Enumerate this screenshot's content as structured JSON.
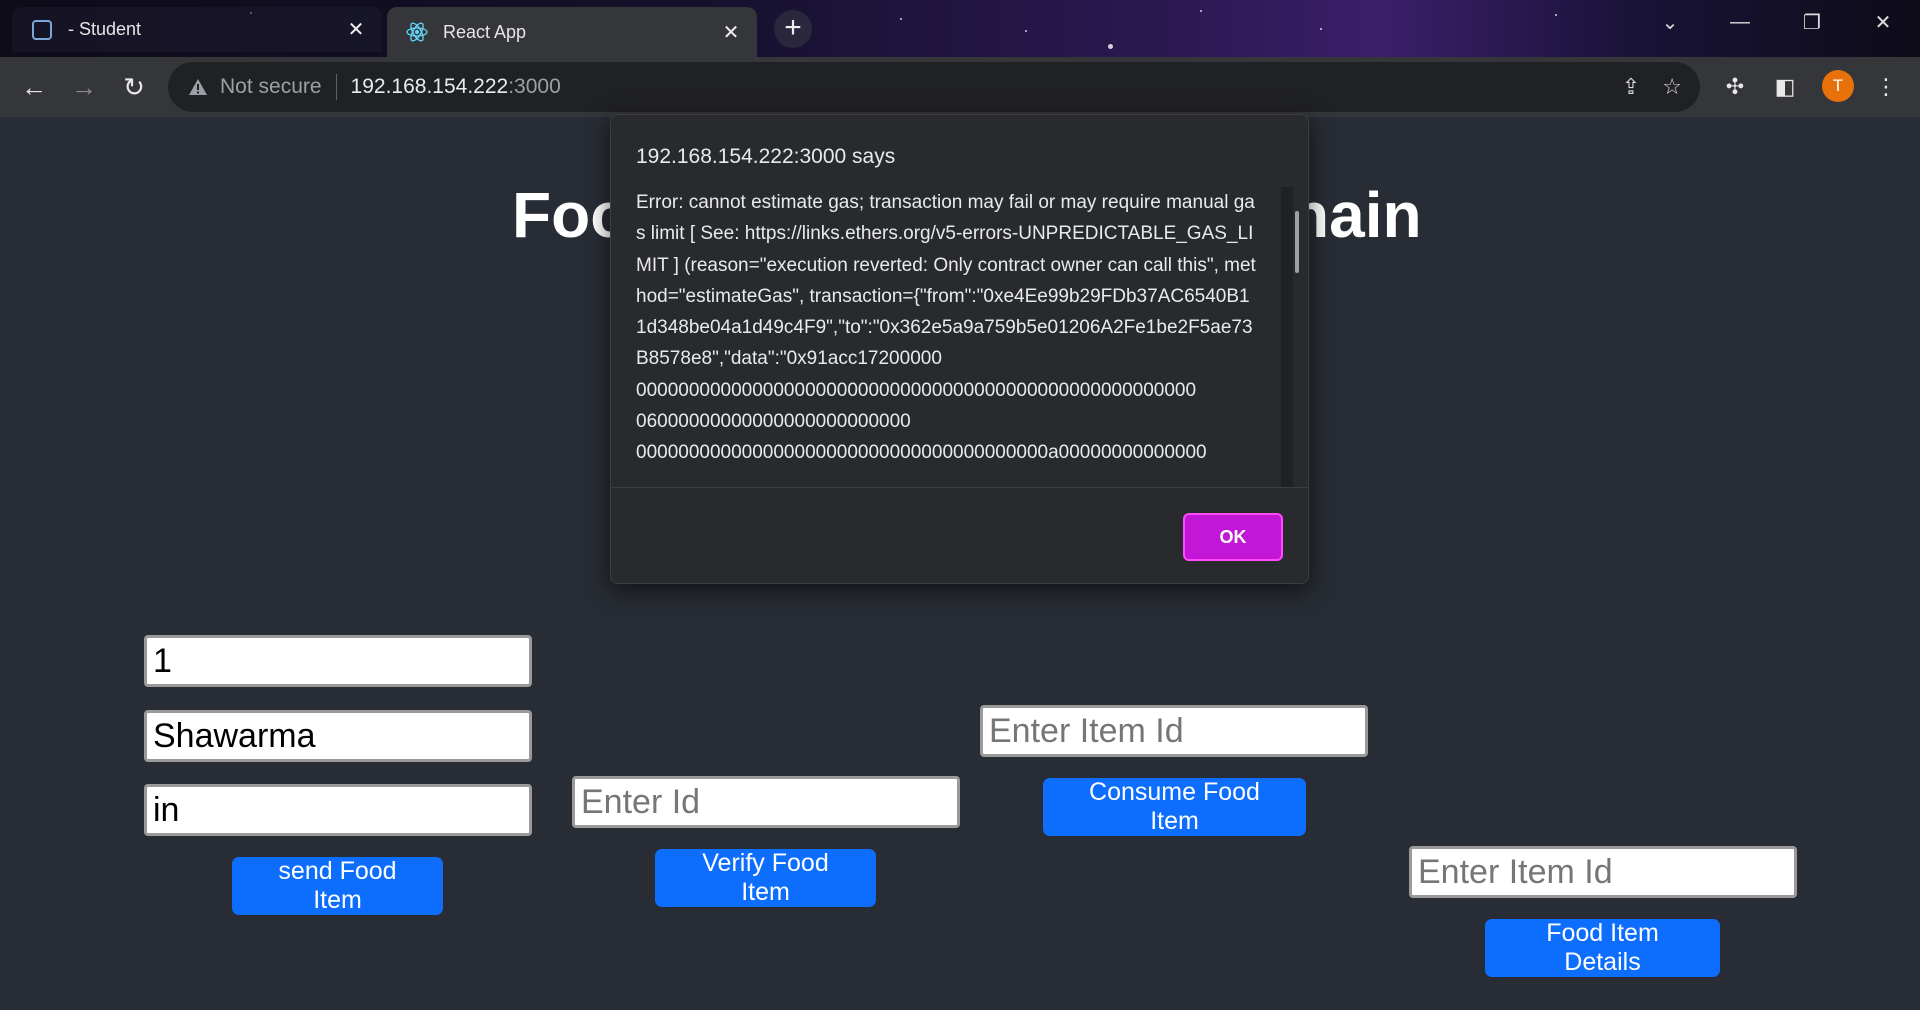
{
  "browser": {
    "tabs": [
      {
        "title": "- Student",
        "active": false
      },
      {
        "title": "React App",
        "active": true
      }
    ],
    "new_tab_label": "+",
    "address": {
      "security_label": "Not secure",
      "host": "192.168.154.222",
      "port": ":3000"
    },
    "avatar_letter": "T",
    "accent_color": "#e8710a"
  },
  "page": {
    "title_left": "Foo",
    "title_right": "nain",
    "send": {
      "id_value": "1",
      "name_value": "Shawarma",
      "origin_value": "in",
      "button_label": "send Food Item"
    },
    "verify": {
      "placeholder": "Enter Id",
      "button_label": "Verify Food Item"
    },
    "consume": {
      "placeholder": "Enter Item Id",
      "button_label": "Consume Food Item"
    },
    "details": {
      "placeholder": "Enter Item Id",
      "button_label": "Food Item Details"
    },
    "button_color": "#0d6efd"
  },
  "dialog": {
    "title": "192.168.154.222:3000 says",
    "message": "Error: cannot estimate gas; transaction may fail or may require manual gas limit [ See: https://links.ethers.org/v5-errors-UNPREDICTABLE_GAS_LIMIT ] (reason=\"execution reverted: Only contract owner can call this\", method=\"estimateGas\", transaction={\"from\":\"0xe4Ee99b29FDb37AC6540B11d348be04a1d49c4F9\",\"to\":\"0x362e5a9a759b5e01206A2Fe1be2F5ae73B8578e8\",\"data\":\"0x91acc17200000\n00000000000000000000000000000000000000000000000000000\n06000000000000000000000000\n000000000000000000000000000000000000000a00000000000000",
    "ok_label": "OK",
    "ok_color": "#c217d6"
  }
}
